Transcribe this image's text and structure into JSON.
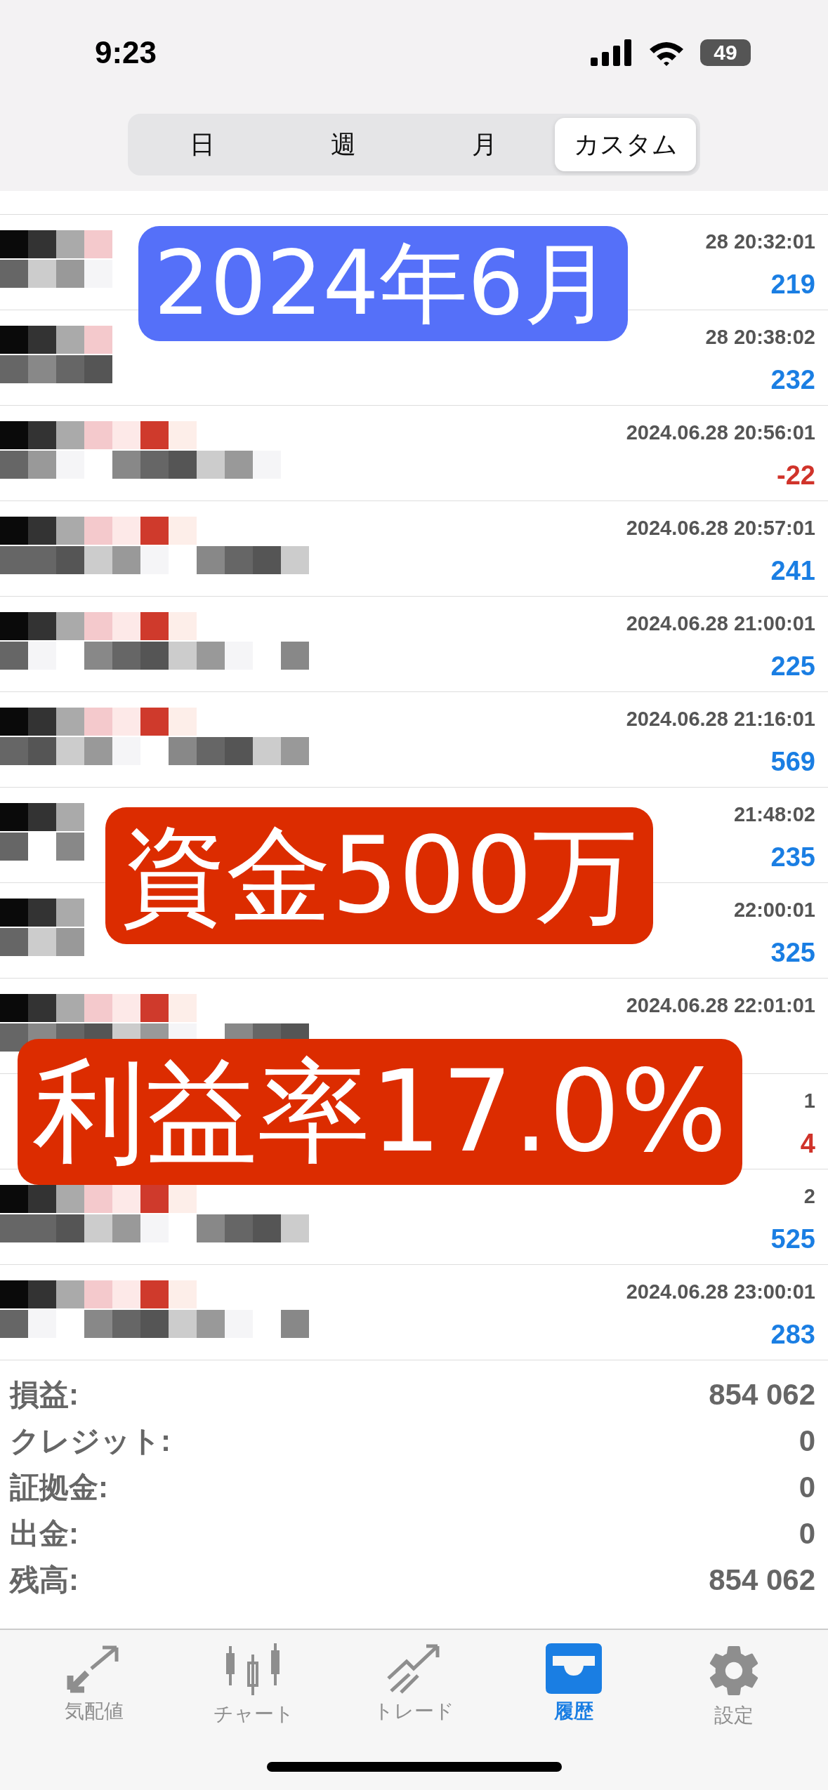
{
  "status_bar": {
    "time": "9:23",
    "battery": "49"
  },
  "period_tabs": [
    {
      "label": "日",
      "selected": false
    },
    {
      "label": "週",
      "selected": false
    },
    {
      "label": "月",
      "selected": false
    },
    {
      "label": "カスタム",
      "selected": true
    }
  ],
  "deals": [
    {
      "date": "28 20:32:01",
      "value": "219",
      "color": "#1a7ee3"
    },
    {
      "date": "28 20:38:02",
      "value": "232",
      "color": "#1a7ee3"
    },
    {
      "date": "2024.06.28 20:56:01",
      "value": "-22",
      "color": "#d0332a"
    },
    {
      "date": "2024.06.28 20:57:01",
      "value": "241",
      "color": "#1a7ee3"
    },
    {
      "date": "2024.06.28 21:00:01",
      "value": "225",
      "color": "#1a7ee3"
    },
    {
      "date": "2024.06.28 21:16:01",
      "value": "569",
      "color": "#1a7ee3"
    },
    {
      "date": "21:48:02",
      "value": "235",
      "color": "#1a7ee3"
    },
    {
      "date": "22:00:01",
      "value": "325",
      "color": "#1a7ee3"
    },
    {
      "date": "2024.06.28 22:01:01"
    },
    {
      "date": "1",
      "value": "4",
      "color": "#d0332a"
    },
    {
      "date": "2",
      "value": "525",
      "color": "#1a7ee3"
    },
    {
      "date": "2024.06.28 23:00:01",
      "value": "283",
      "color": "#1a7ee3"
    }
  ],
  "summary": [
    {
      "label": "損益:",
      "value": "854 062"
    },
    {
      "label": "クレジット:",
      "value": "0"
    },
    {
      "label": "証拠金:",
      "value": "0"
    },
    {
      "label": "出金:",
      "value": "0"
    },
    {
      "label": "残高:",
      "value": "854 062"
    }
  ],
  "overlays": [
    {
      "text": "2024年6月",
      "color": "#5570f9"
    },
    {
      "text": "資金500万",
      "color": "#dc2c00"
    },
    {
      "text": "利益率17.0%",
      "color": "#dc2c00"
    }
  ],
  "tab_bar": [
    {
      "kind": "quotes",
      "label": "気配値",
      "selected": false
    },
    {
      "kind": "chart",
      "label": "チャート",
      "selected": false
    },
    {
      "kind": "trade",
      "label": "トレード",
      "selected": false
    },
    {
      "kind": "history",
      "label": "履歴",
      "selected": true
    },
    {
      "kind": "settings",
      "label": "設定",
      "selected": false
    }
  ]
}
